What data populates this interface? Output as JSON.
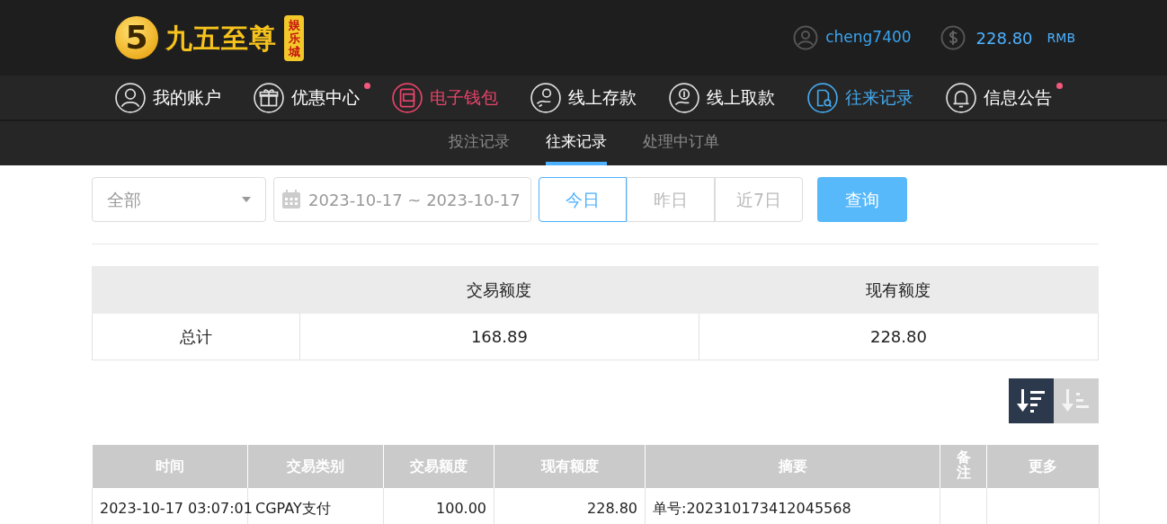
{
  "header": {
    "logo": {
      "digit": "5",
      "name": "九五至尊",
      "badge": "娱乐城"
    },
    "username": "cheng7400",
    "balance": "228.80",
    "currency": "RMB"
  },
  "nav": [
    {
      "label": "我的账户",
      "selected": false,
      "highlight": false,
      "dot": false
    },
    {
      "label": "优惠中心",
      "selected": false,
      "highlight": false,
      "dot": true
    },
    {
      "label": "电子钱包",
      "selected": false,
      "highlight": true,
      "dot": false
    },
    {
      "label": "线上存款",
      "selected": false,
      "highlight": false,
      "dot": false
    },
    {
      "label": "线上取款",
      "selected": false,
      "highlight": false,
      "dot": false
    },
    {
      "label": "往来记录",
      "selected": true,
      "highlight": false,
      "dot": false
    },
    {
      "label": "信息公告",
      "selected": false,
      "highlight": false,
      "dot": true
    }
  ],
  "subtabs": [
    {
      "label": "投注记录",
      "selected": false
    },
    {
      "label": "往来记录",
      "selected": true
    },
    {
      "label": "处理中订单",
      "selected": false
    }
  ],
  "filters": {
    "type": "全部",
    "date_range": "2023-10-17 ~ 2023-10-17",
    "ranges": [
      {
        "label": "今日",
        "selected": true
      },
      {
        "label": "昨日",
        "selected": false
      },
      {
        "label": "近7日",
        "selected": false
      }
    ],
    "search_button": "查询"
  },
  "summary": {
    "columns": [
      "交易额度",
      "现有额度"
    ],
    "label": "总计",
    "values": [
      "168.89",
      "228.80"
    ]
  },
  "sort_buttons": [
    {
      "selected": true
    },
    {
      "selected": false
    }
  ],
  "table": {
    "columns": [
      "时间",
      "交易类别",
      "交易额度",
      "现有额度",
      "摘要",
      "备注",
      "更多"
    ],
    "rows": [
      [
        "2023-10-17 03:07:01",
        "CGPAY支付",
        "100.00",
        "228.80",
        "单号:202310173412045568",
        "",
        ""
      ]
    ]
  }
}
